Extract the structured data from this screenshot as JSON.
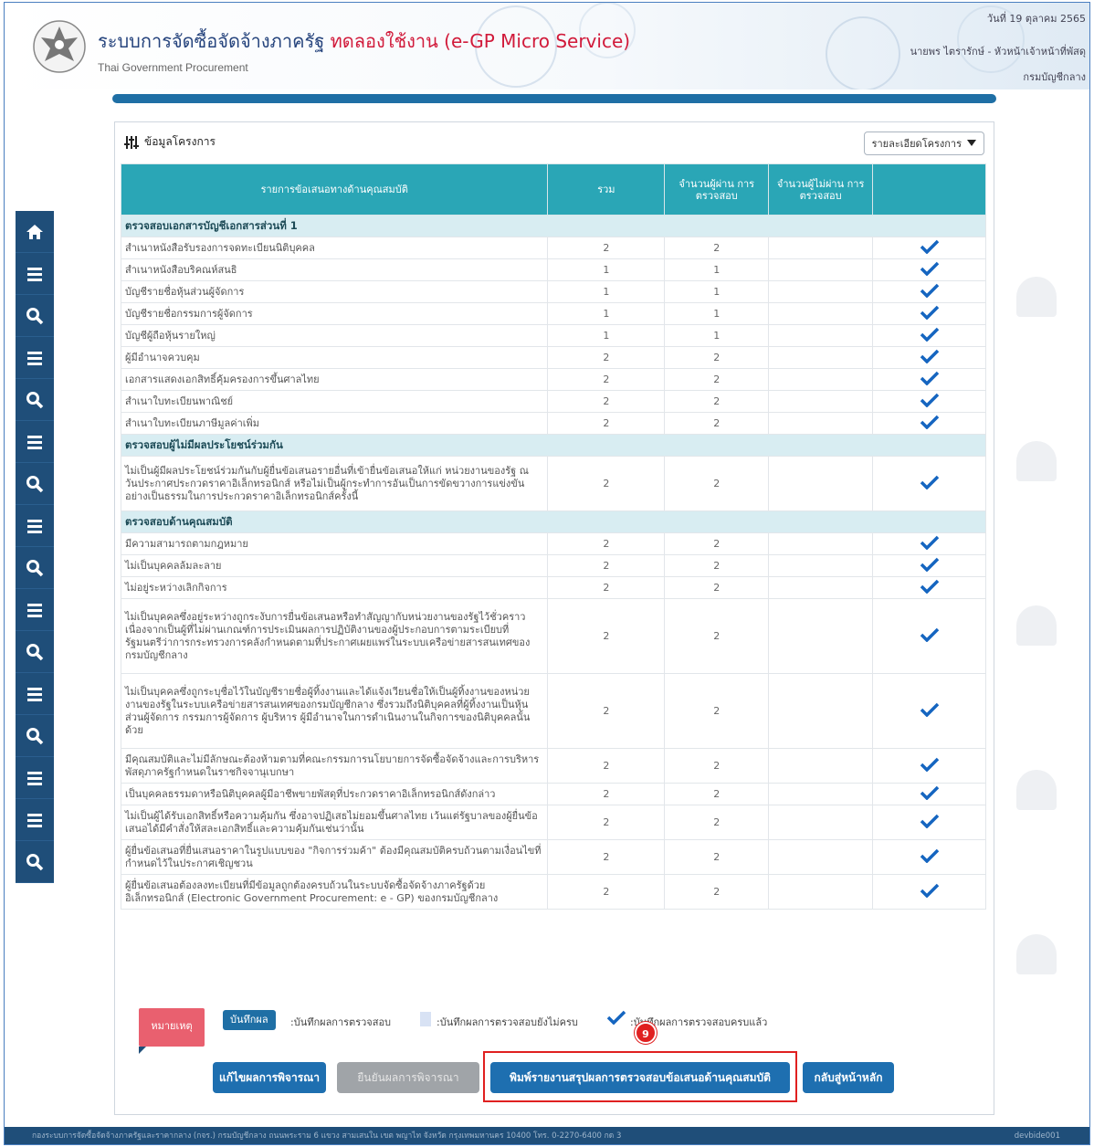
{
  "header": {
    "title_main": "ระบบการจัดซื้อจัดจ้างภาครัฐ",
    "title_test": "ทดลองใช้งาน (e-GP Micro Service)",
    "title_sub": "Thai Government Procurement",
    "date": "วันที่ 19 ตุลาคม 2565",
    "user": "นายพร ไตรารักษ์ - หัวหน้าเจ้าหน้าที่พัสดุ",
    "dept": "กรมบัญชีกลาง"
  },
  "panel": {
    "title": "ข้อมูลโครงการ",
    "detail_button": "รายละเอียดโครงการ"
  },
  "table": {
    "headers": [
      "รายการข้อเสนอทางด้านคุณสมบัติ",
      "รวม",
      "จำนวนผู้ผ่าน การตรวจสอบ",
      "จำนวนผู้ไม่ผ่าน การตรวจสอบ",
      ""
    ],
    "sections": [
      {
        "title": "ตรวจสอบเอกสารบัญชีเอกสารส่วนที่ 1",
        "rows": [
          {
            "label": "สำเนาหนังสือรับรองการจดทะเบียนนิติบุคคล",
            "total": "2",
            "passed": "2",
            "failed": ""
          },
          {
            "label": "สำเนาหนังสือบริคณห์สนธิ",
            "total": "1",
            "passed": "1",
            "failed": ""
          },
          {
            "label": "บัญชีรายชื่อหุ้นส่วนผู้จัดการ",
            "total": "1",
            "passed": "1",
            "failed": ""
          },
          {
            "label": "บัญชีรายชื่อกรรมการผู้จัดการ",
            "total": "1",
            "passed": "1",
            "failed": ""
          },
          {
            "label": "บัญชีผู้ถือหุ้นรายใหญ่",
            "total": "1",
            "passed": "1",
            "failed": ""
          },
          {
            "label": "ผู้มีอำนาจควบคุม",
            "total": "2",
            "passed": "2",
            "failed": ""
          },
          {
            "label": "เอกสารแสดงเอกสิทธิ์คุ้มครองการขึ้นศาลไทย",
            "total": "2",
            "passed": "2",
            "failed": ""
          },
          {
            "label": "สำเนาใบทะเบียนพาณิชย์",
            "total": "2",
            "passed": "2",
            "failed": ""
          },
          {
            "label": "สำเนาใบทะเบียนภาษีมูลค่าเพิ่ม",
            "total": "2",
            "passed": "2",
            "failed": ""
          }
        ]
      },
      {
        "title": "ตรวจสอบผู้ไม่มีผลประโยชน์ร่วมกัน",
        "rows": [
          {
            "label": "ไม่เป็นผู้มีผลประโยชน์ร่วมกันกับผู้ยื่นข้อเสนอรายอื่นที่เข้ายื่นข้อเสนอให้แก่ หน่วยงานของรัฐ ณ วันประกาศประกวดราคาอิเล็กทรอนิกส์ หรือไม่เป็นผู้กระทำการอันเป็นการขัดขวางการแข่งขันอย่างเป็นธรรมในการประกวดราคาอิเล็กทรอนิกส์ครั้งนี้",
            "total": "2",
            "passed": "2",
            "failed": ""
          }
        ]
      },
      {
        "title": "ตรวจสอบด้านคุณสมบัติ",
        "rows": [
          {
            "label": "มีความสามารถตามกฎหมาย",
            "total": "2",
            "passed": "2",
            "failed": ""
          },
          {
            "label": "ไม่เป็นบุคคลล้มละลาย",
            "total": "2",
            "passed": "2",
            "failed": ""
          },
          {
            "label": "ไม่อยู่ระหว่างเลิกกิจการ",
            "total": "2",
            "passed": "2",
            "failed": ""
          },
          {
            "label": "ไม่เป็นบุคคลซึ่งอยู่ระหว่างถูกระงับการยื่นข้อเสนอหรือทำสัญญากับหน่วยงานของรัฐไว้ชั่วคราว เนื่องจากเป็นผู้ที่ไม่ผ่านเกณฑ์การประเมินผลการปฏิบัติงานของผู้ประกอบการตามระเบียบที่รัฐมนตรีว่าการกระทรวงการคลังกำหนดตามที่ประกาศเผยแพร่ในระบบเครือข่ายสารสนเทศของกรมบัญชีกลาง",
            "total": "2",
            "passed": "2",
            "failed": ""
          },
          {
            "label": "ไม่เป็นบุคคลซึ่งถูกระบุชื่อไว้ในบัญชีรายชื่อผู้ทิ้งงานและได้แจ้งเวียนชื่อให้เป็นผู้ทิ้งงานของหน่วยงานของรัฐในระบบเครือข่ายสารสนเทศของกรมบัญชีกลาง ซึ่งรวมถึงนิติบุคคลที่ผู้ทิ้งงานเป็นหุ้นส่วนผู้จัดการ กรรมการผู้จัดการ ผู้บริหาร ผู้มีอำนาจในการดำเนินงานในกิจการของนิติบุคคลนั้นด้วย",
            "total": "2",
            "passed": "2",
            "failed": ""
          },
          {
            "label": "มีคุณสมบัติและไม่มีลักษณะต้องห้ามตามที่คณะกรรมการนโยบายการจัดซื้อจัดจ้างและการบริหารพัสดุภาครัฐกำหนดในราชกิจจานุเบกษา",
            "total": "2",
            "passed": "2",
            "failed": ""
          },
          {
            "label": "เป็นบุคคลธรรมดาหรือนิติบุคคลผู้มีอาชีพขายพัสดุที่ประกวดราคาอิเล็กทรอนิกส์ดังกล่าว",
            "total": "2",
            "passed": "2",
            "failed": ""
          },
          {
            "label": "ไม่เป็นผู้ได้รับเอกสิทธิ์หรือความคุ้มกัน ซึ่งอาจปฏิเสธไม่ยอมขึ้นศาลไทย เว้นแต่รัฐบาลของผู้ยื่นข้อเสนอได้มีคำสั่งให้สละเอกสิทธิ์และความคุ้มกันเช่นว่านั้น",
            "total": "2",
            "passed": "2",
            "failed": ""
          },
          {
            "label": "ผู้ยื่นข้อเสนอที่ยื่นเสนอราคาในรูปแบบของ \"กิจการร่วมค้า\" ต้องมีคุณสมบัติครบถ้วนตามเงื่อนไขที่กำหนดไว้ในประกาศเชิญชวน",
            "total": "2",
            "passed": "2",
            "failed": ""
          },
          {
            "label": "ผู้ยื่นข้อเสนอต้องลงทะเบียนที่มีข้อมูลถูกต้องครบถ้วนในระบบจัดซื้อจัดจ้างภาครัฐด้วยอิเล็กทรอนิกส์ (Electronic Government Procurement: e - GP) ของกรมบัญชีกลาง",
            "total": "2",
            "passed": "2",
            "failed": ""
          }
        ]
      }
    ]
  },
  "legend": {
    "note_tag": "หมายเหตุ",
    "save_label": "บันทึกผล",
    "save_desc": ":บันทึกผลการตรวจสอบ",
    "incomplete_desc": ":บันทึกผลการตรวจสอบยังไม่ครบ",
    "complete_desc": ":บันทึกผลการตรวจสอบครบแล้ว"
  },
  "step_badge": "9",
  "buttons": {
    "edit": "แก้ไขผลการพิจารณา",
    "confirm": "ยืนยันผลการพิจารณา",
    "print": "พิมพ์รายงานสรุปผลการตรวจสอบข้อเสนอด้านคุณสมบัติ",
    "home": "กลับสู่หน้าหลัก"
  },
  "footer": {
    "address": "กองระบบการจัดซื้อจัดจ้างภาครัฐและราคากลาง (กจร.) กรมบัญชีกลาง ถนนพระราม 6 แขวง สามเสนใน เขต พญาไท จังหวัด กรุงเทพมหานคร 10400 โทร. 0-2270-6400 กด 3",
    "code": "devbide001"
  },
  "colors": {
    "brand_blue": "#1f4e79",
    "table_header": "#2aa6b6",
    "section_row": "#d8edf2",
    "highlight_red": "#e02020",
    "check_blue": "#1565c0"
  }
}
